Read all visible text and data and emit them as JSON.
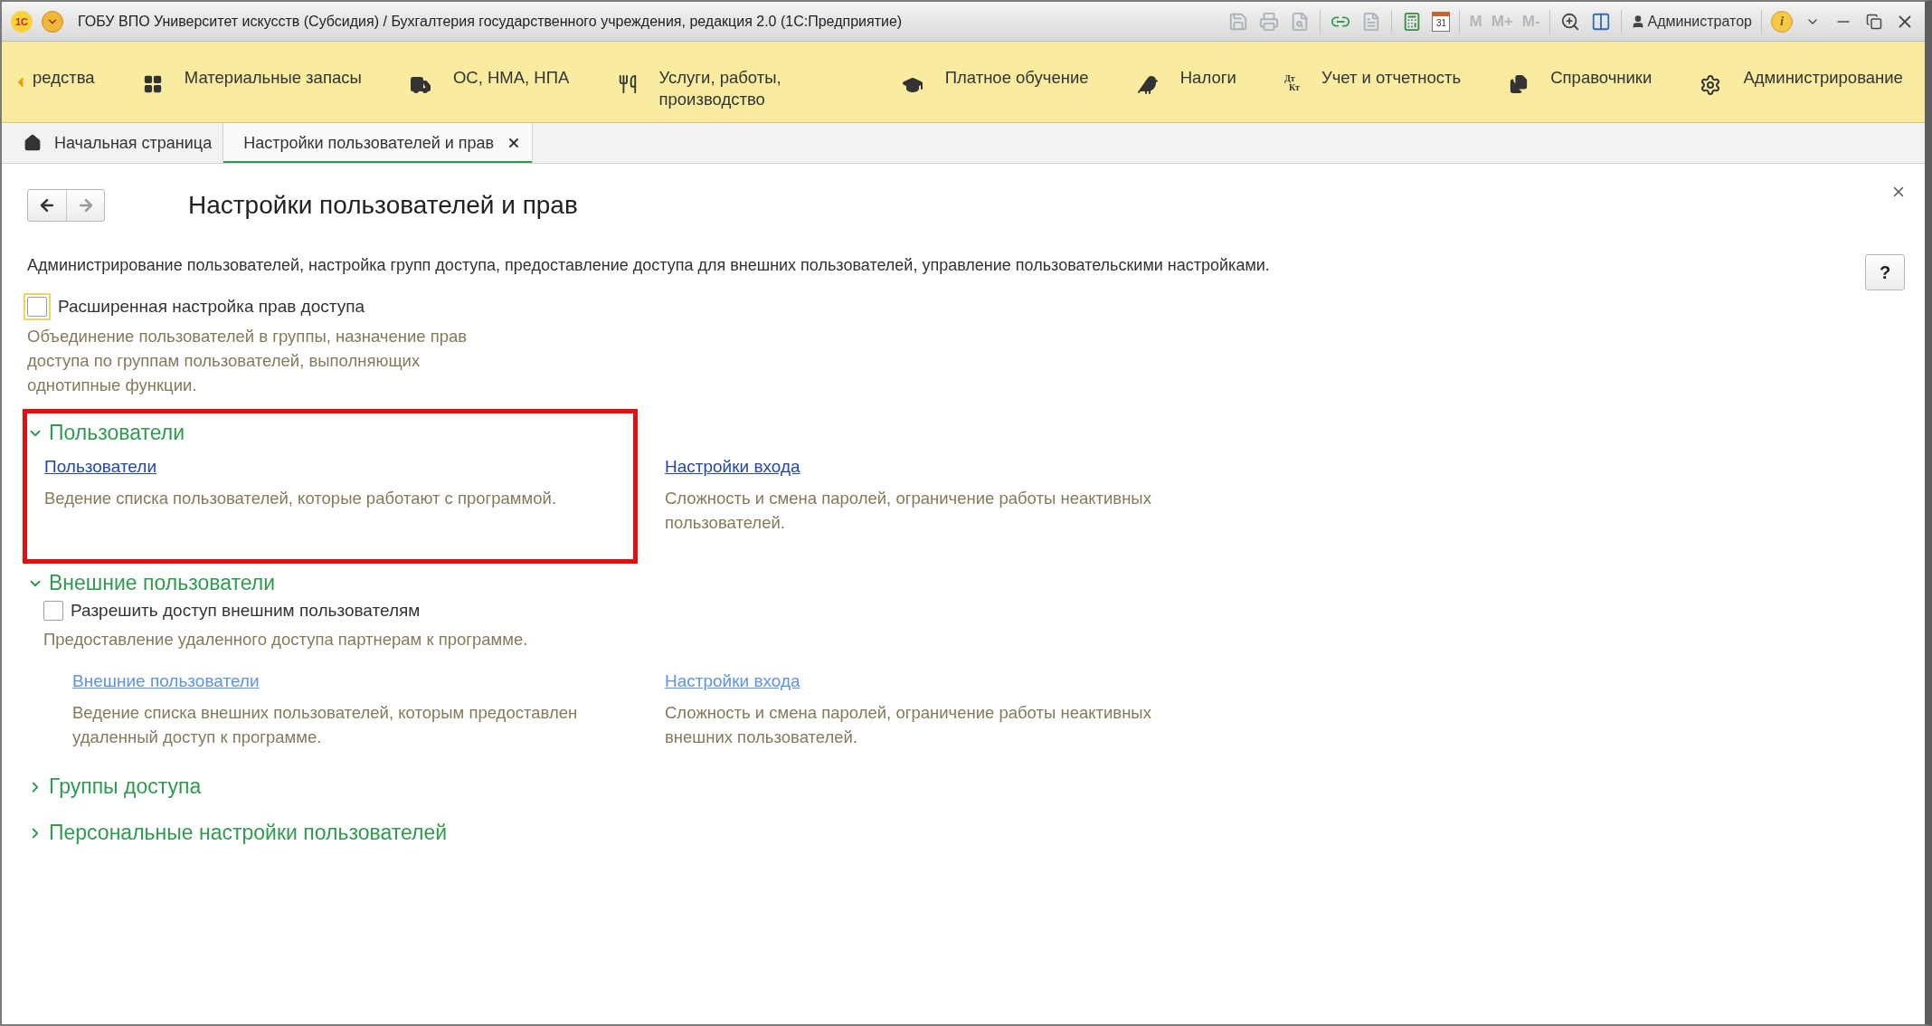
{
  "window": {
    "logo": "1С",
    "title": "ГОБУ ВПО Университет искусств (Субсидия) / Бухгалтерия государственного учреждения, редакция 2.0  (1С:Предприятие)",
    "calendar_day": "31",
    "memory_buttons": [
      "M",
      "M+",
      "M-"
    ],
    "user": "Администратор",
    "info_glyph": "i"
  },
  "sections_menu": [
    {
      "label": "редства"
    },
    {
      "label": "Материальные запасы"
    },
    {
      "label": "ОС, НМА, НПА"
    },
    {
      "label": "Услуги, работы, производство"
    },
    {
      "label": "Платное обучение"
    },
    {
      "label": "Налоги"
    },
    {
      "label": "Учет и отчетность",
      "icon_text": [
        "Дт",
        "Кт"
      ]
    },
    {
      "label": "Справочники"
    },
    {
      "label": "Администрирование"
    }
  ],
  "tabs": [
    {
      "label": "Начальная страница",
      "selected": false,
      "closable": false
    },
    {
      "label": "Настройки пользователей и прав",
      "selected": true,
      "closable": true
    }
  ],
  "page": {
    "title": "Настройки пользователей и прав",
    "description": "Администрирование пользователей, настройка групп доступа, предоставление доступа для внешних пользователей, управление пользовательскими настройками.",
    "help": "?"
  },
  "advanced_access": {
    "label": "Расширенная настройка прав доступа",
    "checked": false,
    "focused": true,
    "hint": "Объединение пользователей в группы, назначение прав доступа по группам пользователей, выполняющих однотипные функции."
  },
  "groups": [
    {
      "title": "Пользователи",
      "expanded": true,
      "highlighted": true,
      "links": [
        {
          "label": "Пользователи",
          "disabled": false,
          "hint": "Ведение списка пользователей, которые работают с программой."
        },
        {
          "label": "Настройки входа",
          "disabled": false,
          "hint": "Сложность и смена паролей, ограничение работы неактивных пользователей."
        }
      ]
    },
    {
      "title": "Внешние пользователи",
      "expanded": true,
      "highlighted": false,
      "checkbox": {
        "label": "Разрешить доступ внешним пользователям",
        "checked": false
      },
      "note": "Предоставление удаленного доступа партнерам к программе.",
      "links": [
        {
          "label": "Внешние пользователи",
          "disabled": true,
          "hint": "Ведение списка внешних пользователей, которым предоставлен удаленный доступ к программе."
        },
        {
          "label": "Настройки входа",
          "disabled": true,
          "hint": "Сложность и смена паролей, ограничение работы неактивных внешних пользователей."
        }
      ]
    },
    {
      "title": "Группы доступа",
      "expanded": false,
      "highlighted": false
    },
    {
      "title": "Персональные настройки пользователей",
      "expanded": false,
      "highlighted": false
    }
  ]
}
